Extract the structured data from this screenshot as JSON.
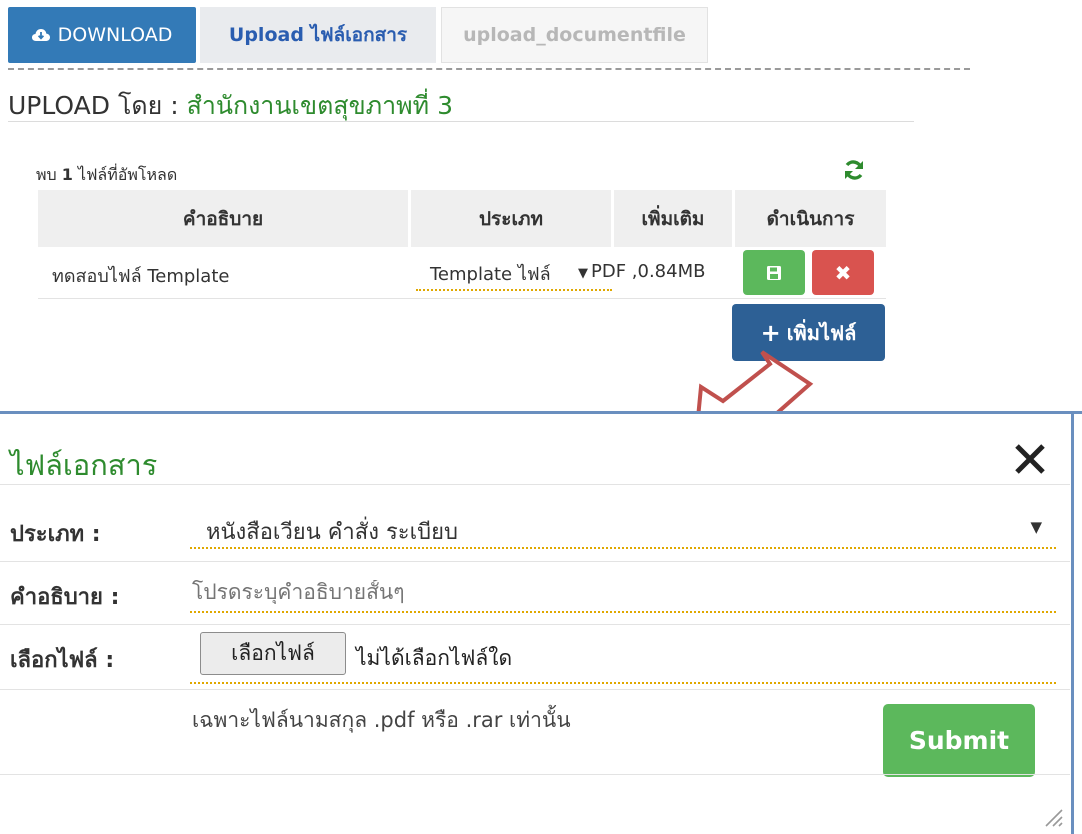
{
  "tabs": {
    "download": "DOWNLOAD",
    "upload": "Upload ไฟล์เอกสาร",
    "documentfile": "upload_documentfile"
  },
  "upload_by": {
    "label": "UPLOAD โดย : ",
    "org": "สำนักงานเขตสุขภาพที่ 3"
  },
  "files": {
    "found_prefix": "พบ ",
    "found_count": "1",
    "found_suffix": " ไฟล์ที่อัพโหลด",
    "headers": [
      "คำอธิบาย",
      "ประเภท",
      "เพิ่มเติม",
      "ดำเนินการ"
    ],
    "rows": [
      {
        "description": "ทดสอบไฟล์ Template",
        "type": "Template ไฟล์",
        "more": "PDF ,0.84MB"
      }
    ],
    "add_button": "เพิ่มไฟล์"
  },
  "modal": {
    "title": "ไฟล์เอกสาร",
    "type_label": "ประเภท :",
    "type_value": "หนังสือเวียน คำสั่ง ระเบียบ",
    "desc_label": "คำอธิบาย :",
    "desc_placeholder": "โปรดระบุคำอธิบายสั้นๆ",
    "file_label": "เลือกไฟล์ :",
    "choose_button": "เลือกไฟล์",
    "no_file": "ไม่ได้เลือกไฟล์ใด",
    "hint": "เฉพาะไฟล์นามสกุล .pdf หรือ .rar เท่านั้น",
    "submit": "Submit"
  },
  "colors": {
    "primary": "#337ab7",
    "success": "#5cb85c",
    "danger": "#d9534f",
    "org_green": "#2e8b2e",
    "arrow": "#c0504d"
  }
}
